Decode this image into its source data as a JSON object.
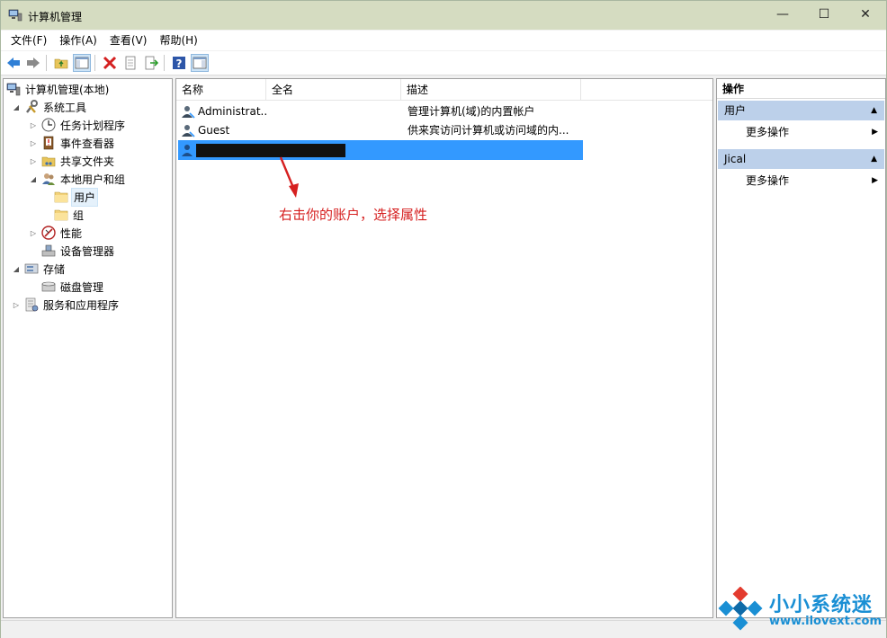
{
  "window": {
    "title": "计算机管理",
    "min_glyph": "—",
    "max_glyph": "☐",
    "close_glyph": "✕"
  },
  "menu": [
    "文件(F)",
    "操作(A)",
    "查看(V)",
    "帮助(H)"
  ],
  "toolbar": [
    "back-arrow-icon",
    "forward-arrow-icon",
    "up-folder-icon",
    "show-hide-tree-icon",
    "delete-icon",
    "properties-icon",
    "export-icon",
    "help-icon",
    "show-hide-action-pane-icon"
  ],
  "tree": [
    {
      "label": "计算机管理(本地)",
      "expander": "",
      "icon": "computer-management-icon"
    },
    {
      "label": "系统工具",
      "expander": "◢",
      "icon": "system-tools-icon"
    },
    {
      "label": "任务计划程序",
      "expander": "▷",
      "icon": "clock-icon"
    },
    {
      "label": "事件查看器",
      "expander": "▷",
      "icon": "event-viewer-icon"
    },
    {
      "label": "共享文件夹",
      "expander": "▷",
      "icon": "shared-folder-icon"
    },
    {
      "label": "本地用户和组",
      "expander": "◢",
      "icon": "users-groups-icon"
    },
    {
      "label": "用户",
      "expander": "",
      "icon": "folder-icon"
    },
    {
      "label": "组",
      "expander": "",
      "icon": "folder-icon"
    },
    {
      "label": "性能",
      "expander": "▷",
      "icon": "performance-icon"
    },
    {
      "label": "设备管理器",
      "expander": "",
      "icon": "device-manager-icon"
    },
    {
      "label": "存储",
      "expander": "◢",
      "icon": "storage-icon"
    },
    {
      "label": "磁盘管理",
      "expander": "",
      "icon": "disk-icon"
    },
    {
      "label": "服务和应用程序",
      "expander": "▷",
      "icon": "services-icon"
    }
  ],
  "list": {
    "columns": [
      "名称",
      "全名",
      "描述"
    ],
    "rows": [
      {
        "name": "Administrat...",
        "fullname": "",
        "description": "管理计算机(域)的内置帐户"
      },
      {
        "name": "Guest",
        "fullname": "",
        "description": "供来宾访问计算机或访问域的内..."
      }
    ],
    "annotation": "右击你的账户，选择属性"
  },
  "actions": {
    "title": "操作",
    "groups": [
      {
        "label": "用户",
        "item": "更多操作"
      },
      {
        "label": "Jical",
        "item": "更多操作"
      }
    ]
  },
  "watermark": {
    "text": "小小系统迷",
    "url": "www.ilovext.com"
  },
  "colors": {
    "accent": "#3399ff",
    "title_bar": "#d5dcc1",
    "action_group": "#bcd0ea",
    "annotation": "#d62020"
  }
}
